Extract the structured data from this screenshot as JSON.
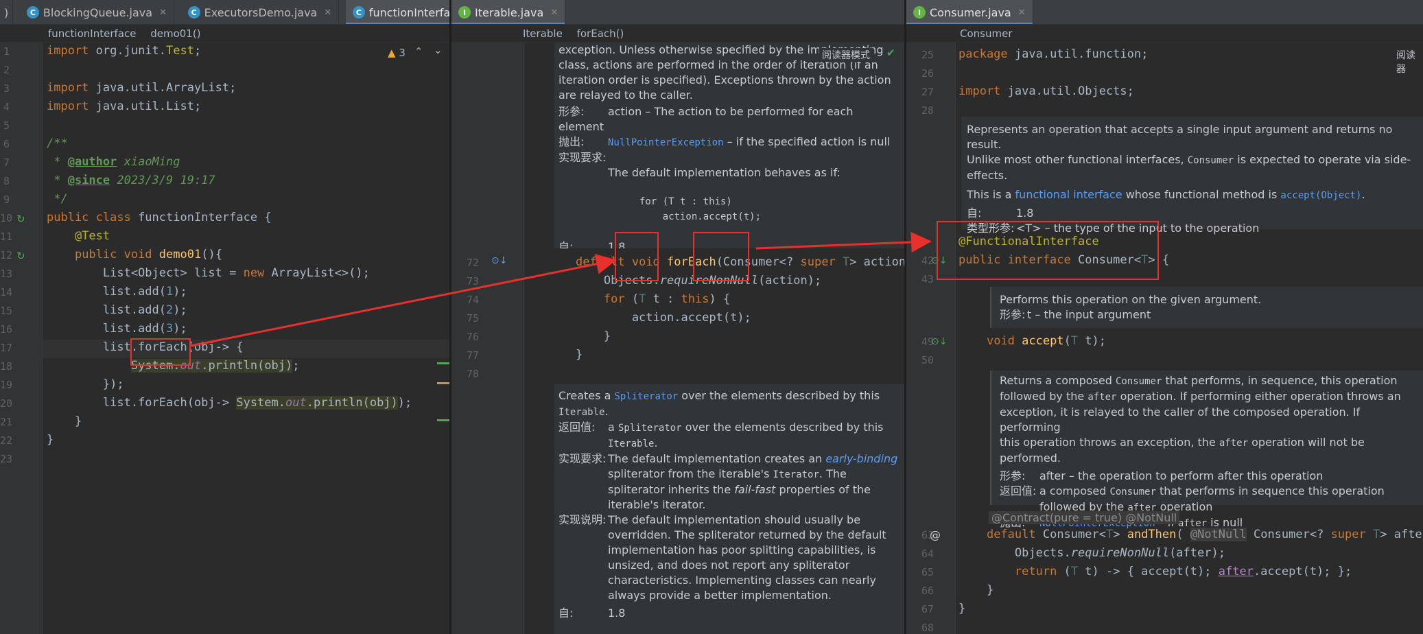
{
  "left_pane": {
    "tabs": [
      {
        "label": ")",
        "icon": "none"
      },
      {
        "label": "BlockingQueue.java",
        "icon": "class-icon"
      },
      {
        "label": "ExecutorsDemo.java",
        "icon": "class-icon"
      },
      {
        "label": "functionInterface.java",
        "icon": "class-icon",
        "active": true
      }
    ],
    "breadcrumb": [
      "functionInterface",
      "demo01()"
    ],
    "warning_count": "3",
    "line_numbers": [
      "1",
      "2",
      "3",
      "4",
      "5",
      "6",
      "7",
      "8",
      "9",
      "10",
      "11",
      "12",
      "13",
      "14",
      "15",
      "16",
      "17",
      "18",
      "19",
      "20",
      "21",
      "22",
      "23"
    ]
  },
  "middle_pane": {
    "tab": "Iterable.java",
    "breadcrumb": [
      "Iterable",
      "forEach()"
    ],
    "reader_mode": "阅读器模式",
    "doc1": {
      "text": "exception. Unless otherwise specified by the implementing class, actions are performed in the order of iteration (if an iteration order is specified). Exceptions thrown by the action are relayed to the caller.",
      "param_label": "形参:",
      "param_text": "action – The action to be performed for each element",
      "throws_label": "抛出:",
      "throws_link": "NullPointerException",
      "throws_text": " – if the specified action is null",
      "impl_req_label": "实现要求:",
      "impl_req_text": "The default implementation behaves as if:",
      "code1": "for (T t : this)",
      "code2": "    action.accept(t);",
      "since_label": "自:",
      "since_value": "1.8"
    },
    "line_numbers": [
      "72",
      "73",
      "74",
      "75",
      "76",
      "77",
      "78"
    ],
    "doc2": {
      "creates": "Creates a ",
      "spliterator_link": "Spliterator",
      "creates_rest": " over the elements described by this",
      "iterable": "Iterable",
      "return_label": "返回值:",
      "return_text_a": "a ",
      "return_mono": "Spliterator",
      "return_text_b": " over the elements described by this",
      "impl_req_label": "实现要求:",
      "impl_req_a": "The default implementation creates an ",
      "early_binding": "early-binding",
      "impl_req_b": "spliterator from the iterable's ",
      "iterator_mono": "Iterator",
      "impl_req_c": ". The",
      "impl_req_d": "spliterator inherits the ",
      "fail_fast": "fail-fast",
      "impl_req_e": " properties of the",
      "impl_req_f": "iterable's iterator.",
      "impl_note_label": "实现说明:",
      "impl_note_lines": [
        "The default implementation should usually be",
        "overridden. The spliterator returned by the default",
        "implementation has poor splitting capabilities, is",
        "unsized, and does not report any spliterator",
        "characteristics. Implementing classes can nearly",
        "always provide a better implementation."
      ],
      "since_label": "自:",
      "since_value": "1.8"
    }
  },
  "right_pane": {
    "tab": "Consumer.java",
    "breadcrumb": [
      "Consumer"
    ],
    "reader_mode": "阅读器",
    "line_numbers_top": [
      "25",
      "26",
      "27",
      "28"
    ],
    "doc1": {
      "line1": "Represents an operation that accepts a single input argument and returns no result.",
      "line2a": "Unlike most other functional interfaces, ",
      "line2_mono": "Consumer",
      "line2b": " is expected to operate via side-",
      "line3": "effects.",
      "line4a": "This is a ",
      "line4_link": "functional interface",
      "line4b": " whose functional method is ",
      "line4_mono": "accept(Object)",
      "line4c": ".",
      "since_label": "自:",
      "since_value": "1.8",
      "type_label": "类型形参:",
      "type_text": "<T> – the type of the input to the operation"
    },
    "doc2": {
      "line1": "Performs this operation on the given argument.",
      "param_label": "形参:",
      "param_text": "t – the input argument"
    },
    "doc3": {
      "lines": [
        "Returns a composed ",
        "followed by the ",
        "exception, it is relayed to the caller of the composed operation. If performing",
        "this operation throws an exception, the "
      ],
      "consumer_mono": "Consumer",
      "after_mono": "after",
      "line1b": " that performs, in sequence, this operation",
      "line2b": " operation. If performing either operation throws an",
      "line4b": " operation will not be performed.",
      "param_label": "形参:",
      "param_text": "after – the operation to perform after this operation",
      "return_label": "返回值:",
      "return_a": "a composed ",
      "return_b": " that performs in sequence this operation",
      "return_c": "followed by the ",
      "return_d": " operation",
      "throws_label": "抛出:",
      "throws_link": "NullPointerException",
      "throws_a": " – if ",
      "throws_b": " is null"
    },
    "contract_hint": "@Contract(pure = true)",
    "notnull_hint": "@NotNull",
    "notnull_hint2": "@NotNull"
  }
}
